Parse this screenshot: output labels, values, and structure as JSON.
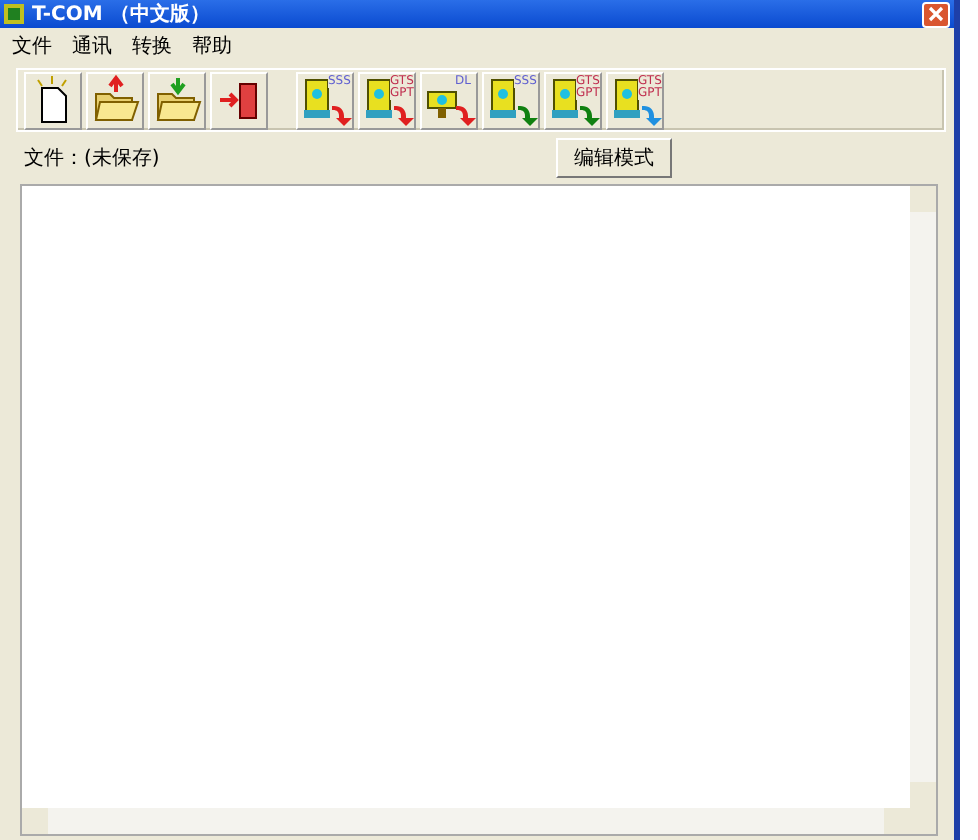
{
  "window": {
    "title": "T-COM （中文版）"
  },
  "menu": [
    "文件",
    "通讯",
    "转换",
    "帮助"
  ],
  "toolbar": [
    {
      "kind": "new"
    },
    {
      "kind": "upload"
    },
    {
      "kind": "download"
    },
    {
      "kind": "exit"
    },
    {
      "kind": "instrument",
      "tag": "SSS",
      "color": "#e02020"
    },
    {
      "kind": "instrument",
      "tag": "GTS GPT",
      "color": "#e02020"
    },
    {
      "kind": "level",
      "tag": "DL",
      "color": "#e02020"
    },
    {
      "kind": "instrument",
      "tag": "SSS",
      "color": "#108010"
    },
    {
      "kind": "instrument",
      "tag": "GTS GPT",
      "color": "#108010"
    },
    {
      "kind": "instrument",
      "tag": "GTS GPT",
      "color": "#2090e0"
    }
  ],
  "file_label": "文件：(未保存)",
  "edit_mode_button": "编辑模式"
}
